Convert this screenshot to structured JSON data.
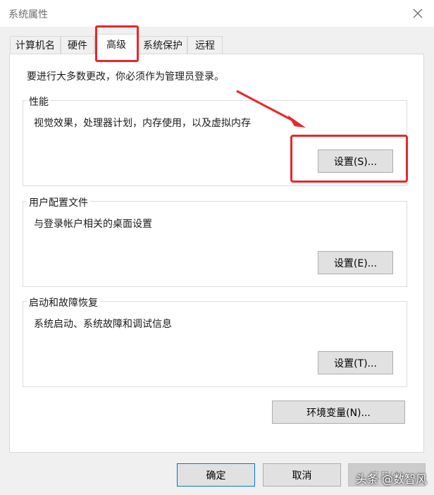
{
  "window": {
    "title": "系统属性"
  },
  "tabs": [
    {
      "label": "计算机名",
      "active": false
    },
    {
      "label": "硬件",
      "active": false
    },
    {
      "label": "高级",
      "active": true
    },
    {
      "label": "系统保护",
      "active": false
    },
    {
      "label": "远程",
      "active": false
    }
  ],
  "advanced": {
    "admin_note": "要进行大多数更改，你必须作为管理员登录。",
    "performance": {
      "title": "性能",
      "description": "视觉效果，处理器计划，内存使用，以及虚拟内存",
      "button": "设置(S)..."
    },
    "user_profiles": {
      "title": "用户配置文件",
      "description": "与登录帐户相关的桌面设置",
      "button": "设置(E)..."
    },
    "startup_recovery": {
      "title": "启动和故障恢复",
      "description": "系统启动、系统故障和调试信息",
      "button": "设置(T)..."
    },
    "env_vars_button": "环境变量(N)..."
  },
  "footer": {
    "ok": "确定",
    "cancel": "取消",
    "apply": "应用(A)"
  },
  "watermark": "头条 @数智风",
  "colors": {
    "annotation_red": "#e8272b",
    "primary_border": "#0078d7"
  },
  "icons": {
    "close": "close-icon",
    "annotation": "arrow-icon"
  }
}
